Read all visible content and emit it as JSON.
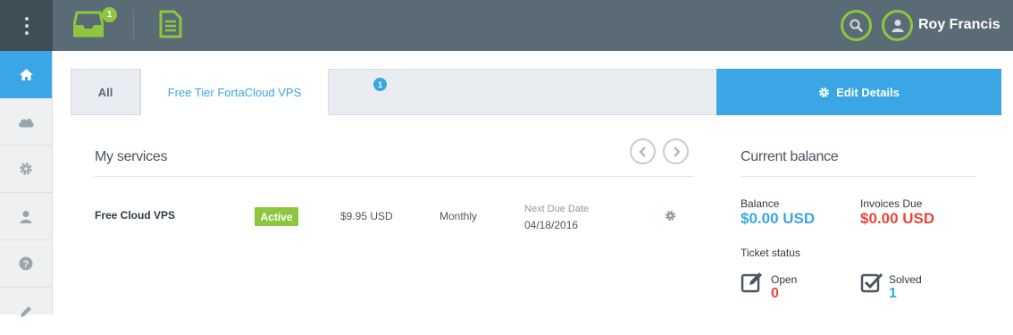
{
  "header": {
    "inbox_badge": "1",
    "user_name": "Roy Francis",
    "icons": [
      "menu-icon",
      "inbox-icon",
      "document-icon",
      "search-icon",
      "user-icon"
    ]
  },
  "sidebar": {
    "items": [
      {
        "icon": "home-icon",
        "active": true
      },
      {
        "icon": "cloud-icon",
        "active": false
      },
      {
        "icon": "gear-icon",
        "active": false
      },
      {
        "icon": "user-icon",
        "active": false
      },
      {
        "icon": "help-icon",
        "active": false
      },
      {
        "icon": "pencil-icon",
        "active": false
      }
    ]
  },
  "tabs": {
    "all_label": "All",
    "vps_label": "Free Tier FortaCloud VPS",
    "vps_badge": "1",
    "edit_label": "Edit Details"
  },
  "services": {
    "title": "My services",
    "rows": [
      {
        "name": "Free Cloud VPS",
        "status": "Active",
        "price": "$9.95 USD",
        "cycle": "Monthly",
        "due_label": "Next Due Date",
        "due_date": "04/18/2016"
      }
    ]
  },
  "balance": {
    "title": "Current balance",
    "balance_label": "Balance",
    "balance_value": "$0.00 USD",
    "invoices_label": "Invoices Due",
    "invoices_value": "$0.00 USD",
    "ticket_title": "Ticket status",
    "open_label": "Open",
    "open_count": "0",
    "solved_label": "Solved",
    "solved_count": "1"
  },
  "colors": {
    "topbar": "#5a6b76",
    "accent_blue": "#3aa6e6",
    "accent_green": "#8dc63f",
    "danger_red": "#e8473b"
  }
}
